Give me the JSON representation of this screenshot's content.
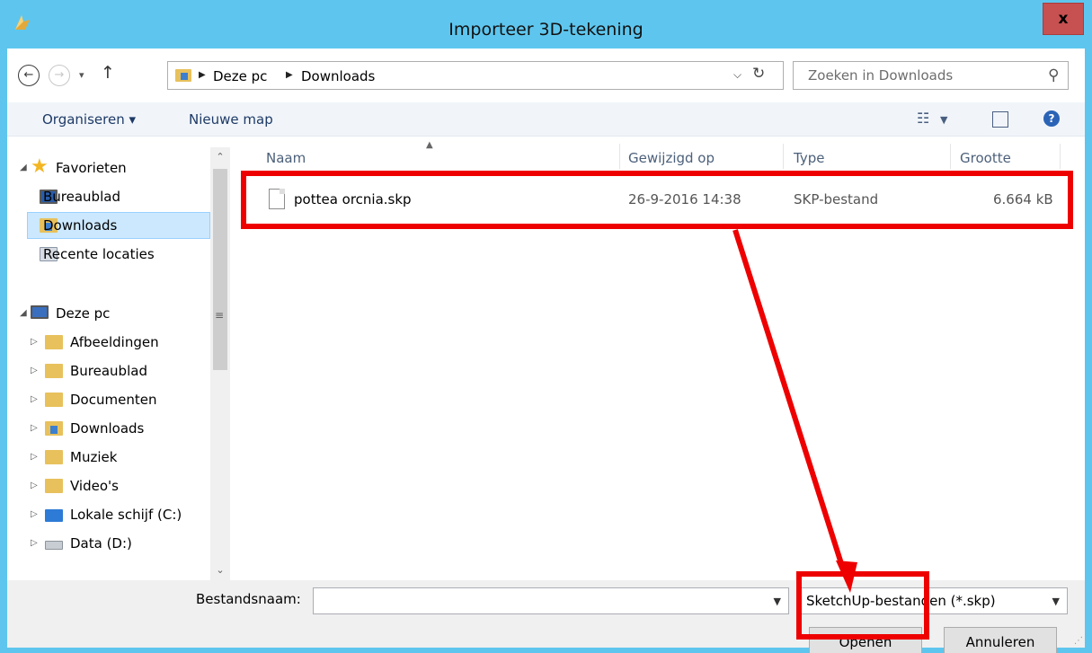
{
  "window": {
    "title": "Importeer 3D-tekening",
    "close_label": "x"
  },
  "navigation": {
    "back_glyph": "←",
    "forward_glyph": "→",
    "recent_glyph": "▾",
    "up_glyph": "↑",
    "breadcrumbs": [
      "Deze pc",
      "Downloads"
    ],
    "search_placeholder": "Zoeken in Downloads"
  },
  "toolbar": {
    "organize_label": "Organiseren ▾",
    "new_folder_label": "Nieuwe map"
  },
  "sidebar": {
    "favorites": {
      "label": "Favorieten",
      "items": [
        "Bureaublad",
        "Downloads",
        "Recente locaties"
      ]
    },
    "this_pc": {
      "label": "Deze pc",
      "items": [
        "Afbeeldingen",
        "Bureaublad",
        "Documenten",
        "Downloads",
        "Muziek",
        "Video's",
        "Lokale schijf (C:)",
        "Data (D:)"
      ]
    },
    "selected": "Downloads"
  },
  "filelist": {
    "columns": [
      "Naam",
      "Gewijzigd op",
      "Type",
      "Grootte"
    ],
    "files": [
      {
        "name": "pottea orcnia.skp",
        "modified": "26-9-2016 14:38",
        "type": "SKP-bestand",
        "size": "6.664 kB"
      }
    ]
  },
  "footer": {
    "filename_label": "Bestandsnaam:",
    "filename_value": "",
    "filter_value": "SketchUp-bestanden (*.skp)",
    "open_label": "Openen",
    "cancel_label": "Annuleren"
  },
  "annotation": {
    "color": "#ee0000"
  }
}
